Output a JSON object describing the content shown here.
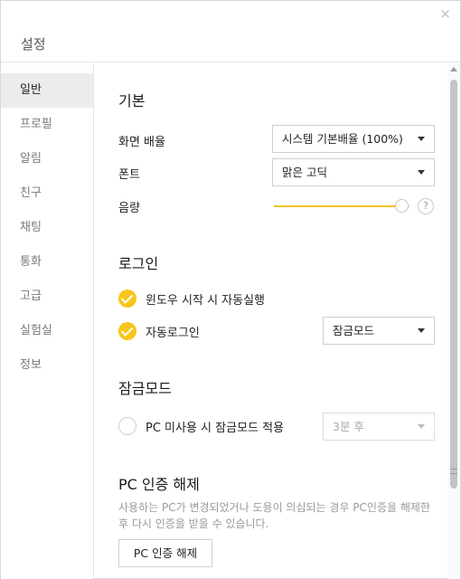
{
  "window": {
    "title": "설정",
    "close_glyph": "×"
  },
  "sidebar": {
    "items": [
      {
        "label": "일반",
        "active": true
      },
      {
        "label": "프로필",
        "active": false
      },
      {
        "label": "알림",
        "active": false
      },
      {
        "label": "친구",
        "active": false
      },
      {
        "label": "채팅",
        "active": false
      },
      {
        "label": "통화",
        "active": false
      },
      {
        "label": "고급",
        "active": false
      },
      {
        "label": "실험실",
        "active": false
      },
      {
        "label": "정보",
        "active": false
      }
    ]
  },
  "basic": {
    "title": "기본",
    "zoom_label": "화면 배율",
    "zoom_value": "시스템 기본배율 (100%)",
    "font_label": "폰트",
    "font_value": "맑은 고딕",
    "volume_label": "음량",
    "volume_level": 1.0,
    "help_glyph": "?"
  },
  "login": {
    "title": "로그인",
    "autostart_label": "윈도우 시작 시 자동실행",
    "autostart_checked": true,
    "autologin_label": "자동로그인",
    "autologin_checked": true,
    "autologin_mode": "잠금모드"
  },
  "lock": {
    "title": "잠금모드",
    "idle_label": "PC 미사용 시 잠금모드 적용",
    "idle_checked": false,
    "idle_time": "3분 후"
  },
  "pc_auth": {
    "title": "PC 인증 해제",
    "description": "사용하는 PC가 변경되었거나 도용이 의심되는 경우 PC인증을 해제한 후 다시 인증을 받을 수 있습니다.",
    "button_label": "PC 인증 해제"
  },
  "colors": {
    "accent": "#f7c51b",
    "active_bg": "#ececec"
  },
  "icons": {
    "close": "close-icon",
    "check": "check-icon",
    "dropdown": "chevron-down-icon",
    "help": "help-icon"
  }
}
